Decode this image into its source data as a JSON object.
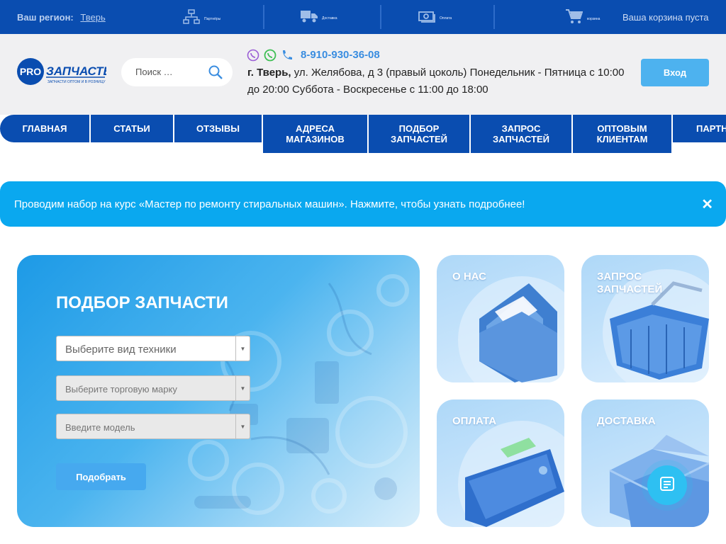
{
  "topbar": {
    "region_label": "Ваш регион:",
    "region_value": "Тверь",
    "items": [
      {
        "label": "Партнёры",
        "icon": "network-icon"
      },
      {
        "label": "Доставка",
        "icon": "truck-icon"
      },
      {
        "label": "Оплата",
        "icon": "money-icon"
      }
    ],
    "cart_label": "корзина",
    "cart_status": "Ваша корзина пуста"
  },
  "header": {
    "logo": {
      "pro": "PRO",
      "name": "ЗАПЧАСТЬ",
      "tagline": "ЗАПЧАСТИ ОПТОМ И В РОЗНИЦУ"
    },
    "search_placeholder": "Поиск …",
    "phone": "8-910-930-36-08",
    "city": "г. Тверь,",
    "address": " ул. Желябова, д 3 (правый цоколь) Понедельник - Пятница с 10:00 до 20:00 Суббота - Воскресенье с 11:00 до 18:00",
    "login": "Вход"
  },
  "nav": [
    {
      "label": "ГЛАВНАЯ"
    },
    {
      "label": "СТАТЬИ"
    },
    {
      "label": "ОТЗЫВЫ"
    },
    {
      "label": "АДРЕСА МАГАЗИНОВ"
    },
    {
      "label": "ПОДБОР ЗАПЧАСТЕЙ"
    },
    {
      "label": "ЗАПРОС ЗАПЧАСТЕЙ"
    },
    {
      "label": "ОПТОВЫМ КЛИЕНТАМ"
    },
    {
      "label": "ПАРТН"
    }
  ],
  "banner": {
    "text": "Проводим набор на курс «Мастер по ремонту стиральных машин». Нажмите, чтобы узнать подробнее!",
    "close": "✕"
  },
  "finder": {
    "title": "ПОДБОР ЗАПЧАСТИ",
    "selects": [
      {
        "value": "Выберите вид техники"
      },
      {
        "value": "Выберите торговую марку"
      },
      {
        "value": "Введите модель"
      }
    ],
    "button": "Подобрать"
  },
  "tiles": [
    {
      "title": "О НАС",
      "icon": "folder-icon"
    },
    {
      "title": "ЗАПРОС ЗАПЧАСТЕЙ",
      "icon": "basket-icon"
    },
    {
      "title": "ОПЛАТА",
      "icon": "wallet-icon"
    },
    {
      "title": "ДОСТАВКА",
      "icon": "box-icon"
    }
  ],
  "colors": {
    "primary": "#0a4db0",
    "accent": "#0aa8ef",
    "button": "#4db2ef"
  }
}
